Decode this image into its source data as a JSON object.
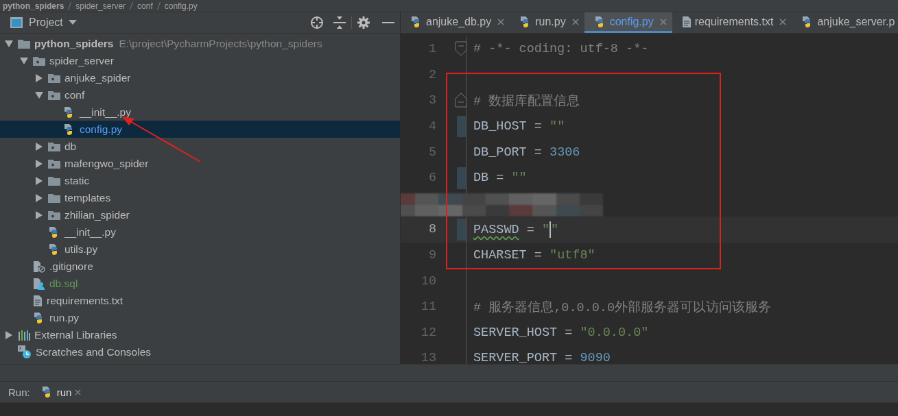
{
  "breadcrumbs": [
    "python_spiders",
    "spider_server",
    "conf",
    "config.py"
  ],
  "project_panel": {
    "title": "Project",
    "tree": [
      {
        "kind": "folder",
        "name": "python_spiders",
        "path": "E:\\project\\PycharmProjects\\python_spiders",
        "expanded": true,
        "selected": false,
        "children": [
          {
            "kind": "package",
            "name": "spider_server",
            "expanded": true,
            "selected": false,
            "children": [
              {
                "kind": "package",
                "name": "anjuke_spider",
                "expanded": false,
                "selected": false
              },
              {
                "kind": "package",
                "name": "conf",
                "expanded": true,
                "selected": false,
                "children": [
                  {
                    "kind": "py",
                    "name": "__init__.py",
                    "selected": false
                  },
                  {
                    "kind": "py",
                    "name": "config.py",
                    "selected": true
                  }
                ]
              },
              {
                "kind": "package",
                "name": "db",
                "expanded": false,
                "selected": false
              },
              {
                "kind": "package",
                "name": "mafengwo_spider",
                "expanded": false,
                "selected": false
              },
              {
                "kind": "folder",
                "name": "static",
                "expanded": false,
                "selected": false
              },
              {
                "kind": "folder",
                "name": "templates",
                "expanded": false,
                "selected": false
              },
              {
                "kind": "package",
                "name": "zhilian_spider",
                "expanded": false,
                "selected": false
              },
              {
                "kind": "py",
                "name": "__init__.py",
                "selected": false
              },
              {
                "kind": "py",
                "name": "utils.py",
                "selected": false
              }
            ]
          },
          {
            "kind": "gitignore",
            "name": ".gitignore",
            "selected": false
          },
          {
            "kind": "sql",
            "name": "db.sql",
            "selected": false,
            "color": "#629755"
          },
          {
            "kind": "text",
            "name": "requirements.txt",
            "selected": false
          },
          {
            "kind": "py",
            "name": "run.py",
            "selected": false
          }
        ]
      },
      {
        "kind": "libraries",
        "name": "External Libraries",
        "expanded": false,
        "selected": false
      },
      {
        "kind": "scratches",
        "name": "Scratches and Consoles",
        "selected": false
      }
    ]
  },
  "editor_tabs": [
    {
      "kind": "py",
      "label": "anjuke_db.py",
      "selected": false
    },
    {
      "kind": "py",
      "label": "run.py",
      "selected": false
    },
    {
      "kind": "py",
      "label": "config.py",
      "selected": true
    },
    {
      "kind": "text",
      "label": "requirements.txt",
      "selected": false
    },
    {
      "kind": "py",
      "label": "anjuke_server.p",
      "selected": false
    }
  ],
  "code_lines": [
    {
      "number": "1",
      "current": false,
      "changed": false,
      "fold_start": true,
      "fold_end": false,
      "tokens": [
        {
          "kind": "comment",
          "text": "# -*- coding: utf-8 -*-"
        }
      ]
    },
    {
      "number": "2",
      "current": false,
      "changed": false,
      "fold_start": false,
      "fold_end": false
    },
    {
      "number": "3",
      "current": false,
      "changed": false,
      "fold_start": false,
      "fold_end": true,
      "tokens": [
        {
          "kind": "comment",
          "text": "# 数据库配置信息"
        }
      ]
    },
    {
      "number": "4",
      "current": false,
      "changed": true,
      "fold_start": false,
      "fold_end": false,
      "tokens": [
        {
          "kind": "ident",
          "text": "DB_HOST = "
        },
        {
          "kind": "string",
          "text": "\"\""
        }
      ]
    },
    {
      "number": "5",
      "current": false,
      "changed": false,
      "fold_start": false,
      "fold_end": false,
      "tokens": [
        {
          "kind": "ident",
          "text": "DB_PORT = "
        },
        {
          "kind": "number",
          "text": "3306"
        }
      ]
    },
    {
      "number": "6",
      "current": false,
      "changed": true,
      "fold_start": false,
      "fold_end": false,
      "tokens": [
        {
          "kind": "ident",
          "text": "DB = "
        },
        {
          "kind": "string",
          "text": "\"\""
        }
      ]
    },
    {
      "kind": "redacted"
    },
    {
      "number": "8",
      "current": true,
      "changed": true,
      "fold_start": false,
      "fold_end": false,
      "tokens": [
        {
          "kind": "typo",
          "text": "PASSWD"
        },
        {
          "kind": "ident",
          "text": " = "
        },
        {
          "kind": "string",
          "text": "\""
        },
        {
          "kind": "caret"
        },
        {
          "kind": "string",
          "text": "\""
        }
      ]
    },
    {
      "number": "9",
      "current": false,
      "changed": false,
      "fold_start": false,
      "fold_end": false,
      "tokens": [
        {
          "kind": "ident",
          "text": "CHARSET = "
        },
        {
          "kind": "string",
          "text": "\"utf8\""
        }
      ]
    },
    {
      "number": "10",
      "current": false,
      "changed": false,
      "fold_start": false,
      "fold_end": false
    },
    {
      "number": "11",
      "current": false,
      "changed": false,
      "fold_start": false,
      "fold_end": false,
      "tokens": [
        {
          "kind": "comment",
          "text": "# 服务器信息,0.0.0.0外部服务器可以访问该服务"
        }
      ]
    },
    {
      "number": "12",
      "current": false,
      "changed": false,
      "fold_start": false,
      "fold_end": false,
      "tokens": [
        {
          "kind": "ident",
          "text": "SERVER_HOST = "
        },
        {
          "kind": "string",
          "text": "\"0.0.0.0\""
        }
      ]
    },
    {
      "number": "13",
      "current": false,
      "changed": false,
      "fold_start": false,
      "fold_end": false,
      "tokens": [
        {
          "kind": "ident",
          "text": "SERVER_PORT = "
        },
        {
          "kind": "number",
          "text": "9090"
        }
      ]
    }
  ],
  "run_bar": {
    "label": "Run:",
    "tabs": [
      {
        "label": "run",
        "selected": true
      }
    ]
  }
}
